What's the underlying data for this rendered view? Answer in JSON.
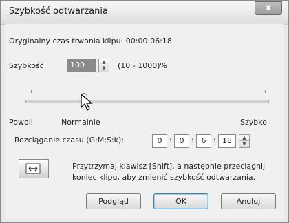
{
  "window": {
    "title": "Szybkość odtwarzania",
    "close_label": "x"
  },
  "info": {
    "original_duration": "Oryginalny czas trwania klipu: 00:00:06:18"
  },
  "speed": {
    "label": "Szybkość:",
    "value": "100",
    "range_hint": "(10 - 1000)%"
  },
  "slider": {
    "left_label": "Powoli",
    "middle_label": "Normalnie",
    "right_label": "Szybko"
  },
  "stretch": {
    "label": "Rozciąganie czasu (G:M:S:k):",
    "hours": "0",
    "minutes": "0",
    "seconds": "6",
    "frames": "18",
    "sep": ":"
  },
  "hint": {
    "line1": "Przytrzymaj klawisz [Shift], a następnie przeciągnij",
    "line2": "koniec klipu, aby zmienić szybkość odtwarzania."
  },
  "buttons": {
    "preview": "Podgląd",
    "ok": "OK",
    "cancel": "Anuluj"
  }
}
